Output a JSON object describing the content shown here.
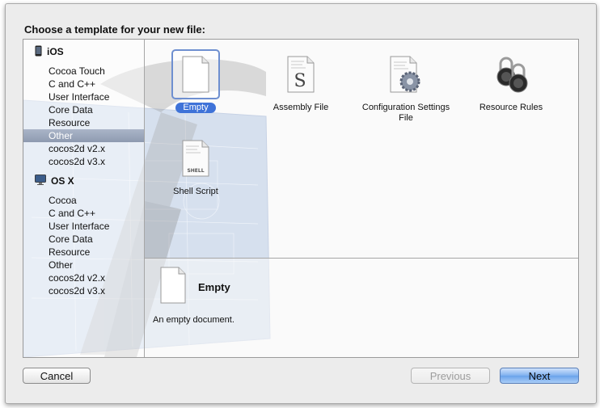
{
  "dialog": {
    "heading": "Choose a template for your new file:"
  },
  "sidebar": {
    "sections": [
      {
        "title": "iOS",
        "icon": "iphone-icon",
        "items": [
          "Cocoa Touch",
          "C and C++",
          "User Interface",
          "Core Data",
          "Resource",
          "Other",
          "cocos2d v2.x",
          "cocos2d v3.x"
        ],
        "selected": "Other"
      },
      {
        "title": "OS X",
        "icon": "mac-icon",
        "items": [
          "Cocoa",
          "C and C++",
          "User Interface",
          "Core Data",
          "Resource",
          "Other",
          "cocos2d v2.x",
          "cocos2d v3.x"
        ]
      }
    ]
  },
  "templates": [
    {
      "label": "Empty",
      "icon": "empty-file-icon",
      "selected": true
    },
    {
      "label": "Assembly File",
      "icon": "assembly-file-icon"
    },
    {
      "label": "Configuration Settings File",
      "icon": "config-settings-file-icon"
    },
    {
      "label": "Resource Rules",
      "icon": "padlocks-icon"
    },
    {
      "label": "Shell Script",
      "icon": "shell-script-icon",
      "icon_text": "SHELL"
    }
  ],
  "assembly_icon_letter": "S",
  "detail": {
    "title": "Empty",
    "description": "An empty document."
  },
  "buttons": {
    "cancel": "Cancel",
    "previous": "Previous",
    "next": "Next"
  },
  "colors": {
    "selection_blue": "#3f73d8",
    "sidebar_selection": "#9aa6bb",
    "default_button": "#7fb0ef"
  }
}
